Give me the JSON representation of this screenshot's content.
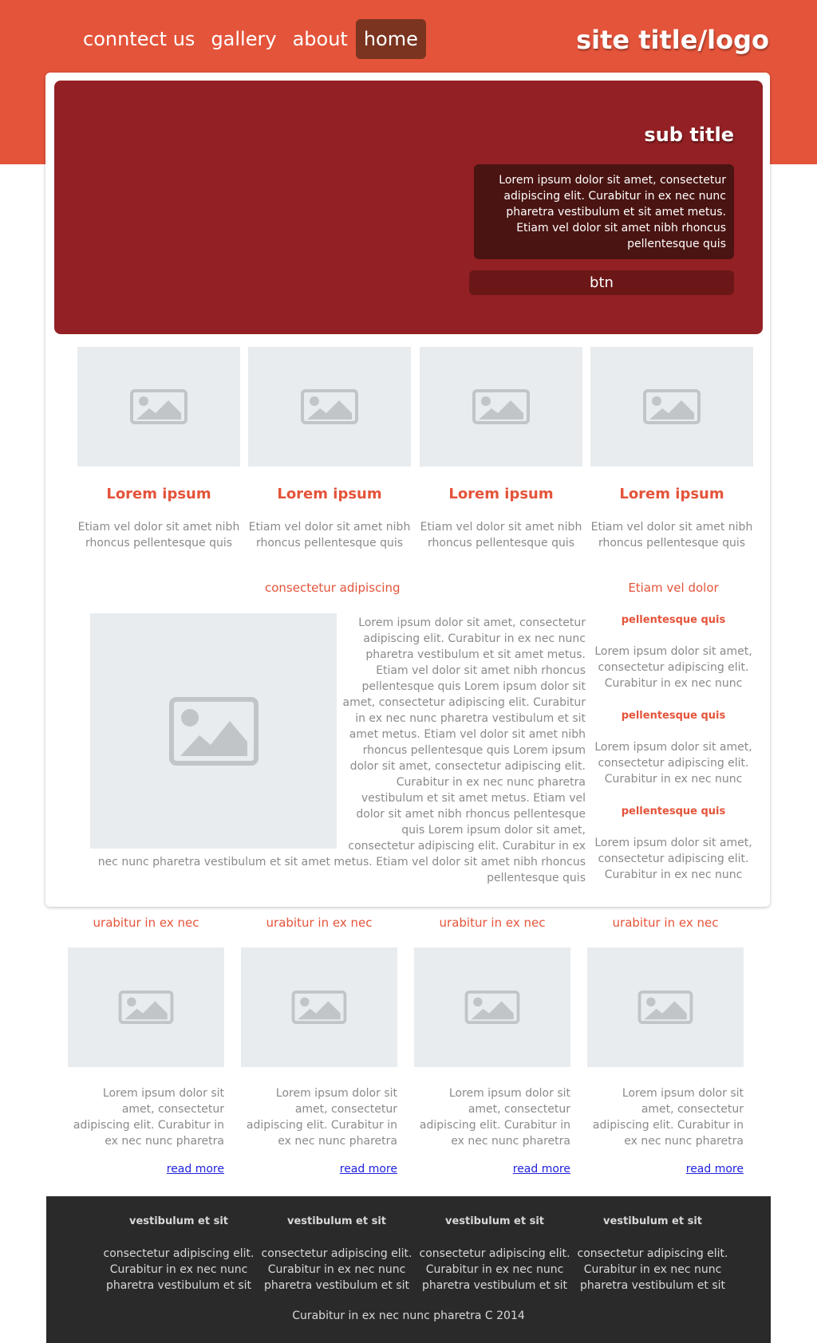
{
  "nav": {
    "items": [
      {
        "label": "conntect us"
      },
      {
        "label": "gallery"
      },
      {
        "label": "about"
      },
      {
        "label": "home"
      }
    ],
    "active": "home"
  },
  "site_title": "site title/logo",
  "hero": {
    "subtitle": "sub title",
    "text": "Lorem ipsum dolor sit amet, consectetur adipiscing elit. Curabitur in ex nec nunc pharetra vestibulum et sit amet metus. Etiam vel dolor sit amet nibh rhoncus pellentesque quis",
    "button": "btn"
  },
  "features": [
    {
      "title": "Lorem ipsum",
      "text": "Etiam vel dolor sit amet nibh rhoncus pellentesque quis",
      "icon": "image-placeholder-icon"
    },
    {
      "title": "Lorem ipsum",
      "text": "Etiam vel dolor sit amet nibh rhoncus pellentesque quis",
      "icon": "image-placeholder-icon"
    },
    {
      "title": "Lorem ipsum",
      "text": "Etiam vel dolor sit amet nibh rhoncus pellentesque quis",
      "icon": "image-placeholder-icon"
    },
    {
      "title": "Lorem ipsum",
      "text": "Etiam vel dolor sit amet nibh rhoncus pellentesque quis",
      "icon": "image-placeholder-icon"
    }
  ],
  "article": {
    "heading": "consectetur adipiscing",
    "text": "Lorem ipsum dolor sit amet, consectetur adipiscing elit. Curabitur in ex nec nunc pharetra vestibulum et sit amet metus. Etiam vel dolor sit amet nibh rhoncus pellentesque quis Lorem ipsum dolor sit amet, consectetur adipiscing elit. Curabitur in ex nec nunc pharetra vestibulum et sit amet metus. Etiam vel dolor sit amet nibh rhoncus pellentesque quis Lorem ipsum dolor sit amet, consectetur adipiscing elit. Curabitur in ex nec nunc pharetra vestibulum et sit amet metus. Etiam vel dolor sit amet nibh rhoncus pellentesque quis Lorem ipsum dolor sit amet, consectetur adipiscing elit. Curabitur in ex",
    "text_tail": "nec nunc pharetra vestibulum et sit amet metus. Etiam vel dolor sit amet nibh rhoncus pellentesque quis"
  },
  "sidebar": {
    "heading": "Etiam vel dolor",
    "items": [
      {
        "title": "pellentesque quis",
        "text": "Lorem ipsum dolor sit amet, consectetur adipiscing elit. Curabitur in ex nec nunc"
      },
      {
        "title": "pellentesque quis",
        "text": "Lorem ipsum dolor sit amet, consectetur adipiscing elit. Curabitur in ex nec nunc"
      },
      {
        "title": "pellentesque quis",
        "text": "Lorem ipsum dolor sit amet, consectetur adipiscing elit. Curabitur in ex nec nunc"
      }
    ]
  },
  "columns": [
    {
      "heading": "urabitur in ex nec",
      "text": "Lorem ipsum dolor sit amet, consectetur adipiscing elit. Curabitur in ex nec nunc pharetra",
      "link": "read more"
    },
    {
      "heading": "urabitur in ex nec",
      "text": "Lorem ipsum dolor sit amet, consectetur adipiscing elit. Curabitur in ex nec nunc pharetra",
      "link": "read more"
    },
    {
      "heading": "urabitur in ex nec",
      "text": "Lorem ipsum dolor sit amet, consectetur adipiscing elit. Curabitur in ex nec nunc pharetra",
      "link": "read more"
    },
    {
      "heading": "urabitur in ex nec",
      "text": "Lorem ipsum dolor sit amet, consectetur adipiscing elit. Curabitur in ex nec nunc pharetra",
      "link": "read more"
    }
  ],
  "footer": {
    "columns": [
      {
        "heading": "vestibulum et sit",
        "text": "consectetur adipiscing elit. Curabitur in ex nec nunc pharetra vestibulum et sit"
      },
      {
        "heading": "vestibulum et sit",
        "text": "consectetur adipiscing elit. Curabitur in ex nec nunc pharetra vestibulum et sit"
      },
      {
        "heading": "vestibulum et sit",
        "text": "consectetur adipiscing elit. Curabitur in ex nec nunc pharetra vestibulum et sit"
      },
      {
        "heading": "vestibulum et sit",
        "text": "consectetur adipiscing elit. Curabitur in ex nec nunc pharetra vestibulum et sit"
      }
    ],
    "copyright": "Curabitur in ex nec nunc pharetra C 2014"
  },
  "colors": {
    "accent": "#e4543a",
    "hero": "#932024",
    "hero_box": "#4a1412",
    "nav_active": "#7a3420",
    "footer": "#2a2a2a",
    "placeholder": "#e8ecef"
  }
}
